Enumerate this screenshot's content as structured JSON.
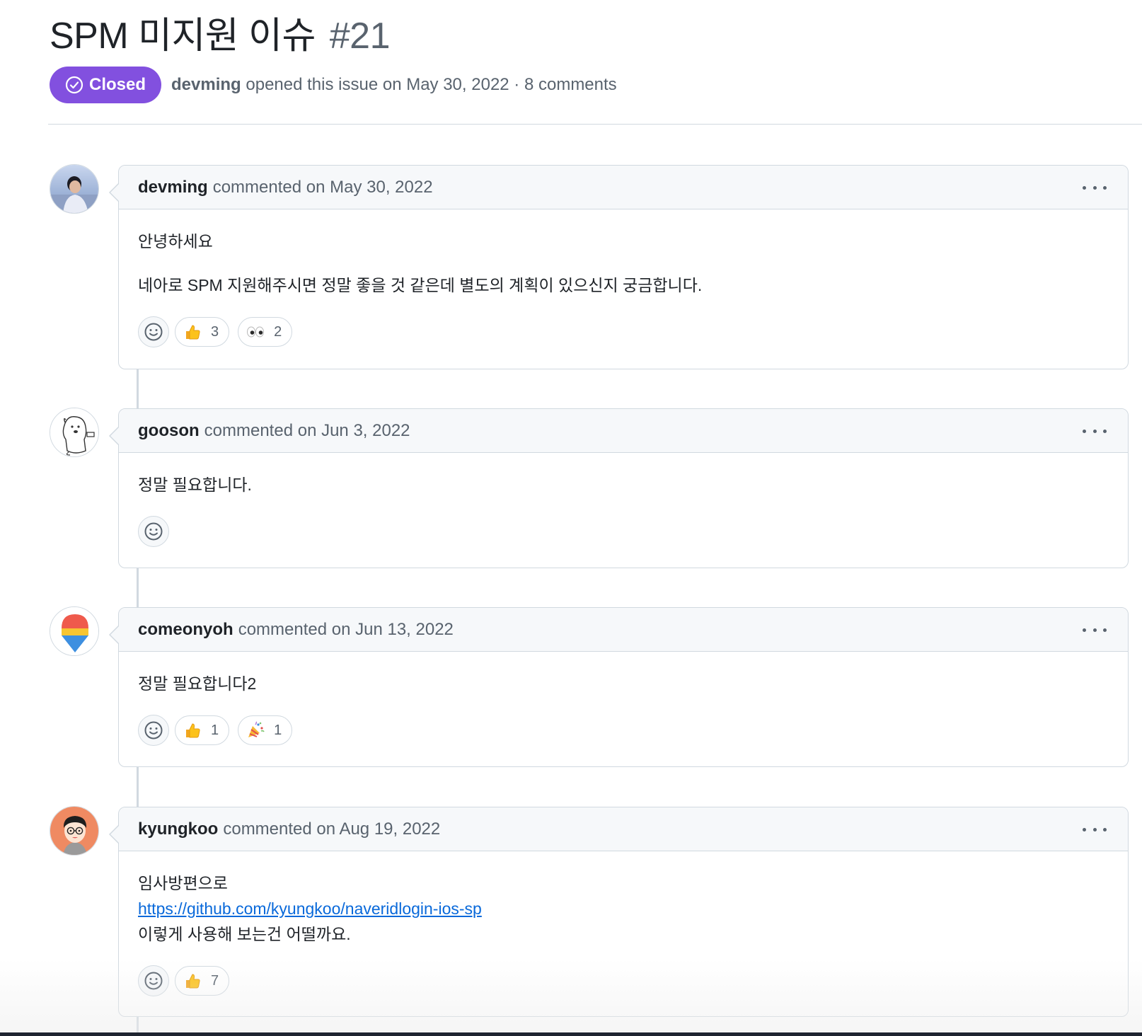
{
  "issue": {
    "title": "SPM 미지원 이슈",
    "number": "#21",
    "state": "Closed",
    "author": "devming",
    "opened_text": "opened this issue on May 30, 2022 · 8 comments"
  },
  "comments": [
    {
      "author": "devming",
      "action": "commented on May 30, 2022",
      "body": [
        "안녕하세요",
        "네아로 SPM 지원해주시면 정말 좋을 것 같은데 별도의 계획이 있으신지 궁금합니다."
      ],
      "reactions": [
        {
          "emoji": "thumbs-up-icon",
          "count": "3"
        },
        {
          "emoji": "eyes-icon",
          "count": "2"
        }
      ]
    },
    {
      "author": "gooson",
      "action": "commented on Jun 3, 2022",
      "body": [
        "정말 필요합니다."
      ],
      "reactions": []
    },
    {
      "author": "comeonyoh",
      "action": "commented on Jun 13, 2022",
      "body": [
        "정말 필요합니다2"
      ],
      "reactions": [
        {
          "emoji": "thumbs-up-icon",
          "count": "1"
        },
        {
          "emoji": "party-popper-icon",
          "count": "1"
        }
      ]
    },
    {
      "author": "kyungkoo",
      "action": "commented on Aug 19, 2022",
      "body": [
        "임사방편으로",
        "https://github.com/kyungkoo/naveridlogin-ios-sp",
        "이렇게 사용해 보는건 어떨까요."
      ],
      "reactions": [
        {
          "emoji": "thumbs-up-icon",
          "count": "7"
        }
      ]
    }
  ],
  "colors": {
    "closed_purple": "#8250df",
    "link_blue": "#0969da",
    "muted_text": "#59636e",
    "border": "#d1d9e0",
    "header_bg": "#f6f8fa"
  }
}
